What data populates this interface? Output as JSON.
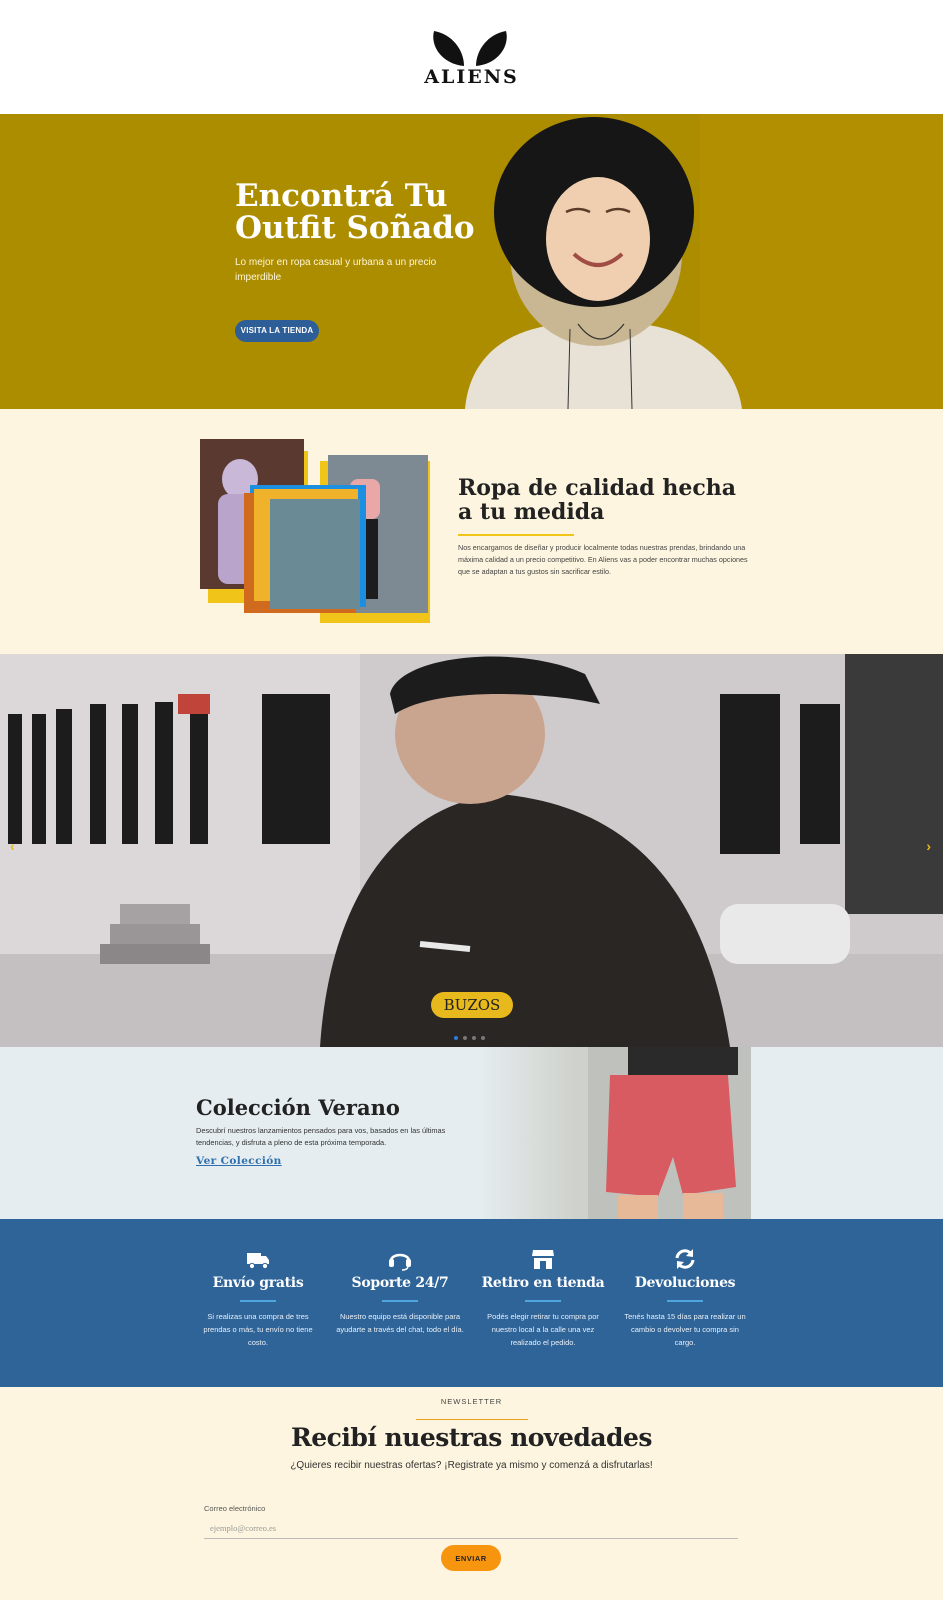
{
  "brand": {
    "name": "ALIENS"
  },
  "hero": {
    "title": "Encontrá Tu Outfit Soñado",
    "subtitle": "Lo mejor en ropa casual y urbana a un precio imperdible",
    "cta_label": "VISITA LA TIENDA",
    "bg_color": "#ad8d00"
  },
  "quality": {
    "title": "Ropa de calidad hecha a tu medida",
    "text": "Nos encargamos de diseñar y producir localmente todas nuestras prendas, brindando una máxima calidad a un precio competitivo. En Aliens vas a poder encontrar muchas opciones que se adaptan a tus gustos sin sacrificar estilo."
  },
  "slider": {
    "current_label": "BUZOS",
    "prev_icon": "chevron-left-icon",
    "next_icon": "chevron-right-icon",
    "slide_count": 4,
    "active_index": 0
  },
  "summer": {
    "title": "Colección Verano",
    "text": "Descubrí nuestros lanzamientos pensados para vos, basados en las últimas tendencias, y disfruta a pleno de esta próxima temporada.",
    "link_label": "Ver Colección"
  },
  "features": [
    {
      "icon": "truck-icon",
      "title": "Envío gratis",
      "text": "Si realizas una compra de tres prendas o más, tu envío no tiene costo."
    },
    {
      "icon": "headset-icon",
      "title": "Soporte 24/7",
      "text": "Nuestro equipo está disponible para ayudarte a través del chat, todo el día."
    },
    {
      "icon": "store-icon",
      "title": "Retiro en tienda",
      "text": "Podés elegir retirar tu compra por nuestro local a la calle una vez realizado el pedido."
    },
    {
      "icon": "refresh-icon",
      "title": "Devoluciones",
      "text": "Tenés hasta 15 días para realizar un cambio o devolver tu compra sin cargo."
    }
  ],
  "newsletter": {
    "kicker": "NEWSLETTER",
    "title": "Recibí nuestras novedades",
    "subtitle": "¿Quieres recibir nuestras ofertas? ¡Registrate ya mismo y comenzá a disfrutarlas!",
    "email_label": "Correo electrónico",
    "email_placeholder": "ejemplo@correo.es",
    "submit_label": "ENVIAR"
  },
  "colors": {
    "accent_yellow": "#f0c419",
    "accent_blue": "#2f6499",
    "accent_orange": "#f7950f",
    "cream": "#fdf5df"
  }
}
